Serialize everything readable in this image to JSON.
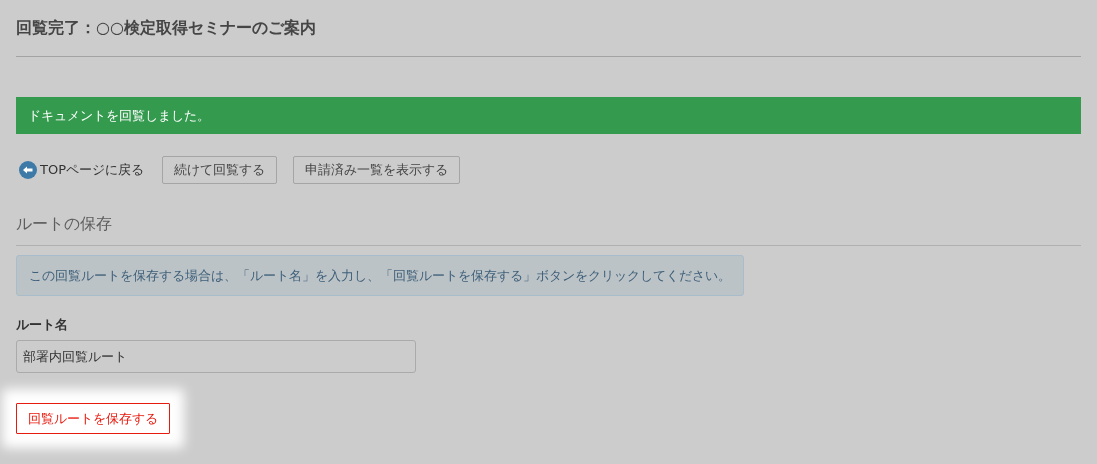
{
  "page_title": "回覧完了：○○検定取得セミナーのご案内",
  "alert": "ドキュメントを回覧しました。",
  "actions": [
    {
      "kind": "link",
      "label": "TOPページに戻る"
    },
    {
      "kind": "button",
      "label": "続けて回覧する"
    },
    {
      "kind": "button",
      "label": "申請済み一覧を表示する"
    }
  ],
  "section": {
    "heading": "ルートの保存",
    "info": "この回覧ルートを保存する場合は、「ルート名」を入力し、「回覧ルートを保存する」ボタンをクリックしてください。",
    "field": {
      "label": "ルート名",
      "value": "部署内回覧ルート"
    },
    "save_button": {
      "label": "回覧ルートを保存する",
      "highlighted": true
    }
  }
}
